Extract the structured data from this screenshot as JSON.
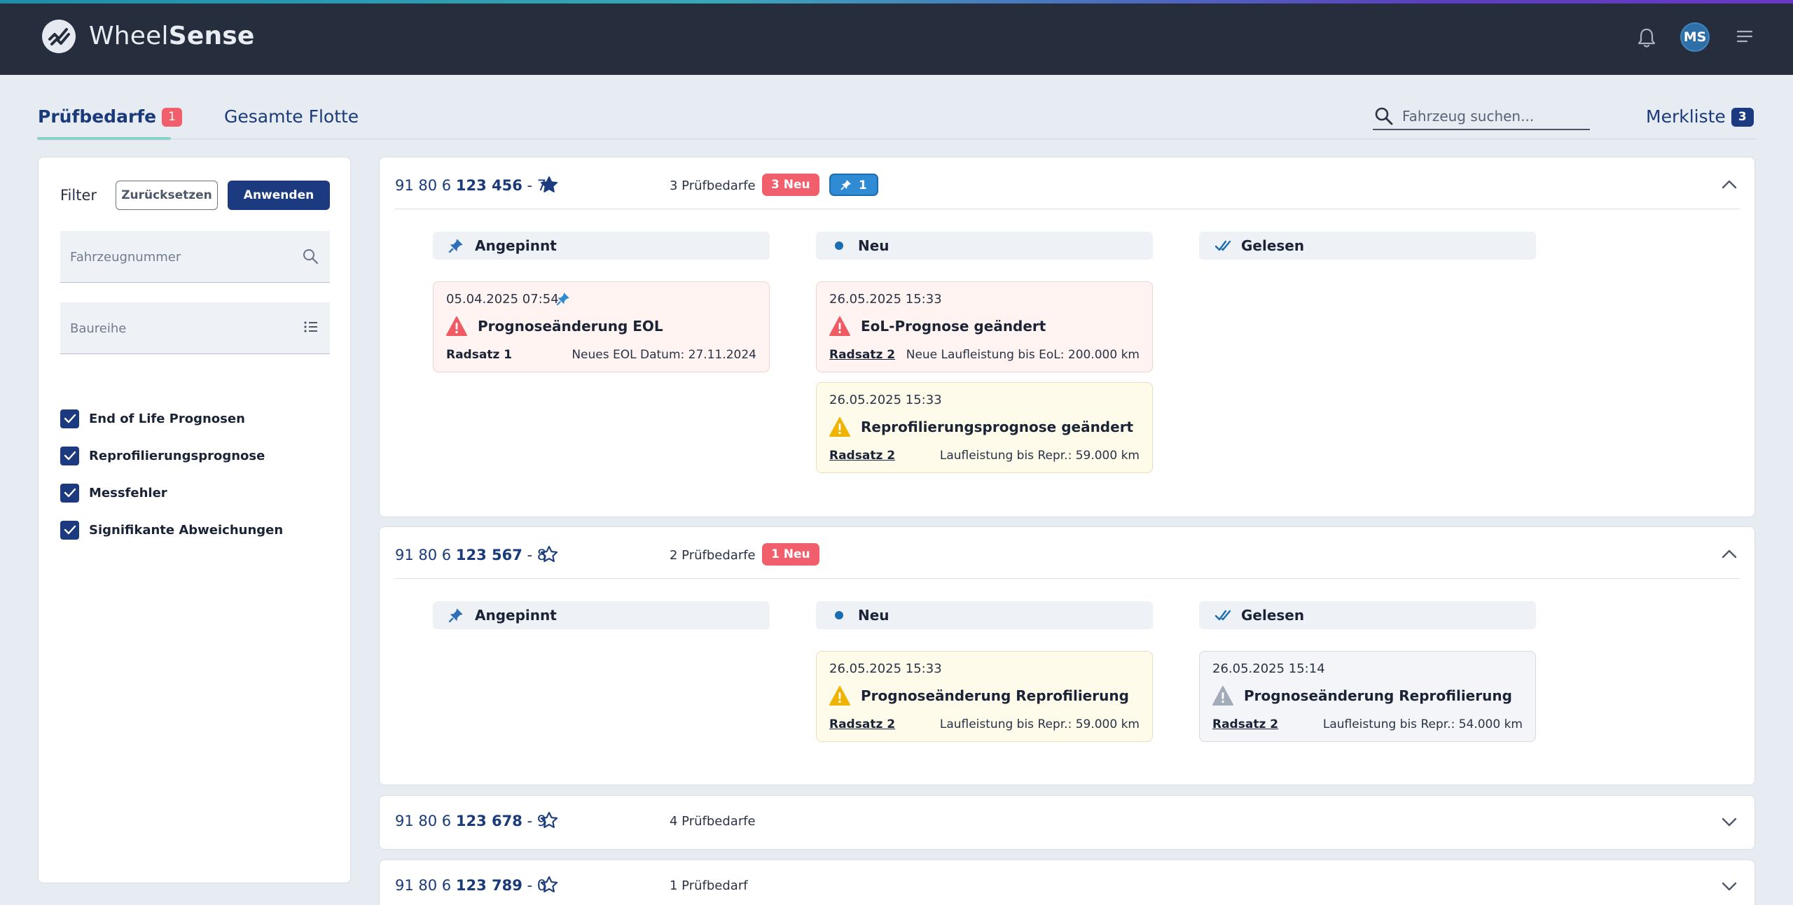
{
  "app": {
    "logo_light": "Wheel",
    "logo_bold": "Sense",
    "avatar_initials": "MS"
  },
  "tabs": {
    "active_label": "Prüfbedarfe",
    "active_badge": "1",
    "inactive_label": "Gesamte Flotte"
  },
  "search": {
    "placeholder": "Fahrzeug suchen..."
  },
  "merkliste": {
    "label": "Merkliste",
    "badge": "3"
  },
  "filter": {
    "label": "Filter",
    "reset_label": "Zurücksetzen",
    "apply_label": "Anwenden",
    "vehicle_number_placeholder": "Fahrzeugnummer",
    "series_placeholder": "Baureihe",
    "checks": [
      {
        "label": "End of Life Prognosen",
        "checked": true
      },
      {
        "label": "Reprofilierungsprognose",
        "checked": true
      },
      {
        "label": "Messfehler",
        "checked": true
      },
      {
        "label": "Signifikante Abweichungen",
        "checked": true
      }
    ]
  },
  "columns": {
    "pinned": "Angepinnt",
    "new": "Neu",
    "read": "Gelesen"
  },
  "vehicles": [
    {
      "prefix": "91 80 6 ",
      "number": "123 456",
      "suffix": " - 7",
      "starred": true,
      "count": "3 Prüfbedarfe",
      "new_badge": "3 Neu",
      "pin_badge": "1",
      "expanded": true,
      "pinned": [
        {
          "date": "05.04.2025 07:54",
          "title": "Prognoseänderung EOL",
          "radsatz": "Radsatz 1",
          "info": "Neues EOL Datum: 27.11.2024",
          "severity": "red"
        }
      ],
      "new": [
        {
          "date": "26.05.2025 15:33",
          "title": "EoL-Prognose geändert",
          "radsatz": "Radsatz 2",
          "info": "Neue Laufleistung bis EoL: 200.000 km",
          "severity": "red"
        },
        {
          "date": "26.05.2025 15:33",
          "title": "Reprofilierungsprognose geändert",
          "radsatz": "Radsatz 2",
          "info": "Laufleistung bis Repr.: 59.000 km",
          "severity": "yellow"
        }
      ],
      "read": []
    },
    {
      "prefix": "91 80 6 ",
      "number": "123 567",
      "suffix": " - 8",
      "starred": false,
      "count": "2 Prüfbedarfe",
      "new_badge": "1 Neu",
      "expanded": true,
      "pinned": [],
      "new": [
        {
          "date": "26.05.2025 15:33",
          "title": "Prognoseänderung Reprofilierung",
          "radsatz": "Radsatz 2",
          "info": "Laufleistung bis Repr.: 59.000 km",
          "severity": "yellow"
        }
      ],
      "read": [
        {
          "date": "26.05.2025 15:14",
          "title": "Prognoseänderung Reprofilierung",
          "radsatz": "Radsatz 2",
          "info": "Laufleistung bis Repr.: 54.000 km",
          "severity": "grey"
        }
      ]
    },
    {
      "prefix": "91 80 6 ",
      "number": "123 678",
      "suffix": " - 9",
      "starred": false,
      "count": "4 Prüfbedarfe",
      "expanded": false
    },
    {
      "prefix": "91 80 6 ",
      "number": "123 789",
      "suffix": " - 0",
      "starred": false,
      "count": "1 Prüfbedarf",
      "expanded": false
    }
  ],
  "colors": {
    "navy": "#1c3a80",
    "red_badge": "#f25f6c",
    "pin_blue": "#2e8bd4",
    "header_bg": "#262e3e",
    "tab_underline": "#6fcfbe"
  }
}
